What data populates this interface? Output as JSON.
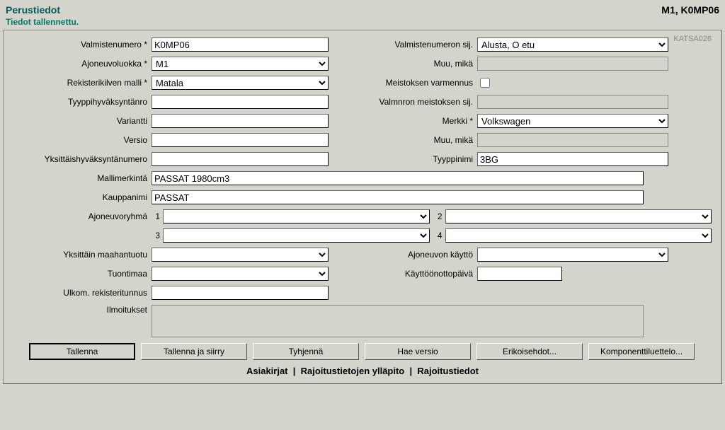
{
  "header": {
    "title": "Perustiedot",
    "right": "M1, K0MP06"
  },
  "status": "Tiedot tallennettu.",
  "panel_code": "KATSA026",
  "labels": {
    "valmistenumero": "Valmistenumero *",
    "valmistenumeron_sij": "Valmistenumeron sij.",
    "ajoneuvoluokka": "Ajoneuvoluokka *",
    "muu_mika": "Muu, mikä",
    "rekisterikilven_malli": "Rekisterikilven malli *",
    "meistoksen_varmenus": "Meistoksen varmennus",
    "tyyppihyv": "Tyyppihyväksyntänro",
    "valmnron_meist_sij": "Valmnron meistoksen sij.",
    "variantti": "Variantti",
    "merkki": "Merkki *",
    "versio": "Versio",
    "muu_mika2": "Muu, mikä",
    "yksittaishyv": "Yksittäishyväksyntänumero",
    "tyyppinimi": "Tyyppinimi",
    "mallimerkinta": "Mallimerkintä",
    "kauppanimi": "Kauppanimi",
    "ajoneuvoryhma": "Ajoneuvoryhmä",
    "yksittain_maahantuotu": "Yksittäin maahantuotu",
    "ajoneuvon_kaytto": "Ajoneuvon käyttö",
    "tuontimaa": "Tuontimaa",
    "kayttoonottopaiva": "Käyttöönottopäivä",
    "ulkom_rekisteritunnus": "Ulkom. rekisteritunnus",
    "ilmoitukset": "Ilmoitukset"
  },
  "values": {
    "valmistenumero": "K0MP06",
    "valmistenumeron_sij": "Alusta, O etu",
    "ajoneuvoluokka": "M1",
    "rekisterikilven_malli": "Matala",
    "merkki": "Volkswagen",
    "tyyppinimi": "3BG",
    "mallimerkinta": "PASSAT 1980cm3",
    "kauppanimi": "PASSAT",
    "g1": "1",
    "g2": "2",
    "g3": "3",
    "g4": "4"
  },
  "buttons": {
    "tallenna": "Tallenna",
    "tallenna_siirry": "Tallenna ja siirry",
    "tyhjenna": "Tyhjennä",
    "hae_versio": "Hae versio",
    "erikoisehdot": "Erikoisehdot...",
    "komponentit": "Komponenttiluettelo..."
  },
  "links": {
    "asiakirjat": "Asiakirjat",
    "rajoitus_yllapito": "Rajoitustietojen ylläpito",
    "rajoitustiedot": "Rajoitustiedot"
  }
}
